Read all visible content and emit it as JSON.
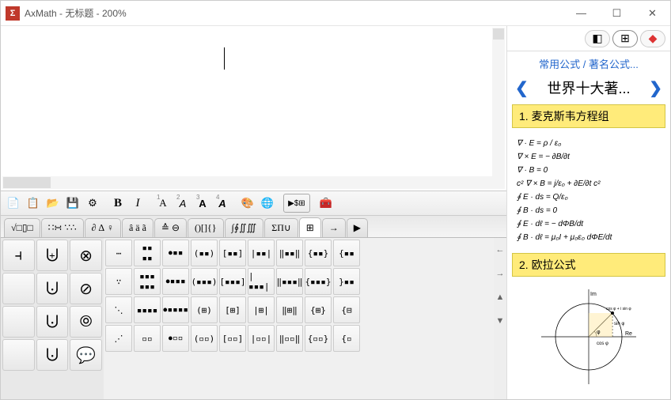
{
  "window": {
    "app_icon_text": "Σ",
    "title": "AxMath - 无标题 - 200%"
  },
  "toolbar": {
    "bold": "B",
    "italic": "I"
  },
  "tabs": [
    "√□▯□",
    "∷∺ ∵∴",
    "∂ ∆ ♀",
    "â ä ã",
    "≙ ⊖",
    "()[]{}",
    "∫∮∬∭",
    "ΣΠ∪",
    "⊞",
    "→",
    "▶"
  ],
  "palette_left": [
    "⫞",
    "⨄",
    "⊗",
    "",
    "⨃",
    "⊘",
    "",
    "⨃",
    "⦾",
    "",
    "⨃",
    "💬"
  ],
  "sidebar": {
    "breadcrumb": "常用公式 / 著名公式...",
    "nav_title": "世界十大著...",
    "section1": "1. 麦克斯韦方程组",
    "maxwell": [
      "∇ · E = ρ / ε₀",
      "∇ × E = − ∂B/∂t",
      "∇ · B = 0",
      "c² ∇ × B = j/ε₀ + ∂E/∂t c²",
      "∮ E · ds = Q/ε₀",
      "∮ B · ds = 0",
      "∮ E · dℓ = − dΦB/dt",
      "∮ B · dℓ = μ₀I + μ₀ε₀ dΦE/dt"
    ],
    "section2": "2. 欧拉公式",
    "euler_labels": {
      "im": "Im",
      "re": "Re",
      "cos": "cos φ",
      "sin": "sin φ",
      "expr": "cos φ + i sin φ"
    }
  }
}
